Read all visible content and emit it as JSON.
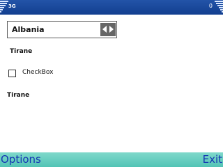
{
  "status_bar": {
    "network": "3G",
    "right_text": "0",
    "icons": [
      "signal-icon",
      "battery-icon"
    ]
  },
  "form": {
    "country_select": {
      "value": "Albania",
      "icon": "left-right-arrows-icon"
    },
    "capital_label_top": "Tirane",
    "checkbox": {
      "label": "CheckBox",
      "checked": false
    },
    "capital_label_bottom": "Tirane"
  },
  "softkeys": {
    "left": "Options",
    "right": "Exit"
  },
  "colors": {
    "status_bar": "#1d4fa3",
    "softkey_bar": "#64cfc1",
    "softkey_text": "#1537b3",
    "arrow_box": "#666666"
  }
}
